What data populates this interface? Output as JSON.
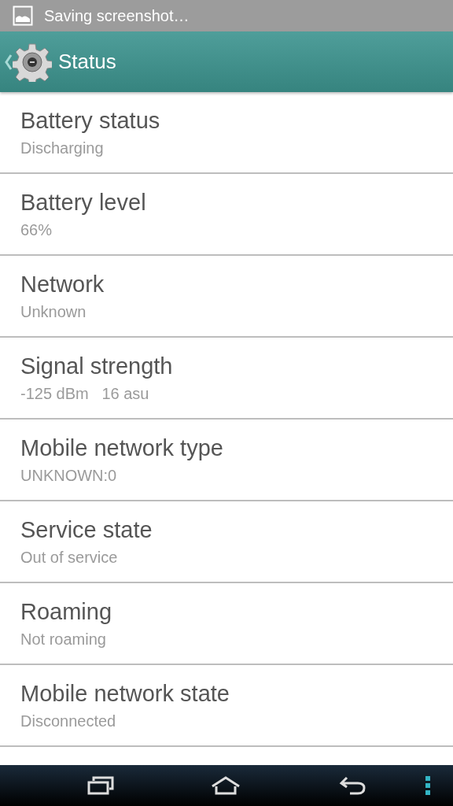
{
  "notification": {
    "text": "Saving screenshot…"
  },
  "action_bar": {
    "title": "Status"
  },
  "items": [
    {
      "title": "Battery status",
      "value": "Discharging"
    },
    {
      "title": "Battery level",
      "value": "66%"
    },
    {
      "title": "Network",
      "value": "Unknown"
    },
    {
      "title": "Signal strength",
      "value": "-125 dBm   16 asu"
    },
    {
      "title": "Mobile network type",
      "value": "UNKNOWN:0"
    },
    {
      "title": "Service state",
      "value": "Out of service"
    },
    {
      "title": "Roaming",
      "value": "Not roaming"
    },
    {
      "title": "Mobile network state",
      "value": "Disconnected"
    }
  ]
}
